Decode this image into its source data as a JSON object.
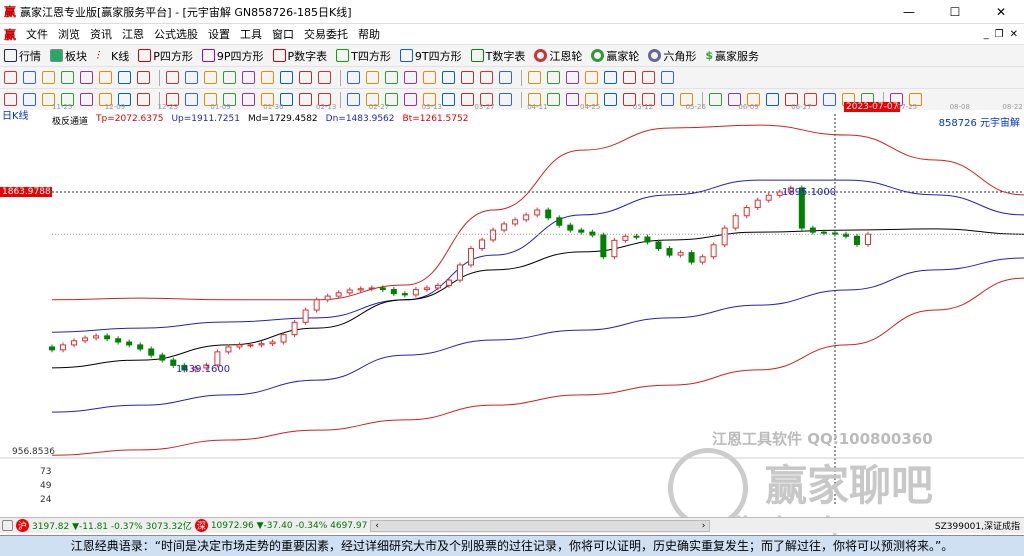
{
  "window": {
    "title": "赢家江恩专业版[赢家服务平台] - [元宇宙解  GN858726-185日K线]",
    "minimize": "—",
    "maximize": "☐",
    "close": "✕"
  },
  "menu": [
    "文件",
    "浏览",
    "资讯",
    "江恩",
    "公式选股",
    "设置",
    "工具",
    "窗口",
    "交易委托",
    "帮助"
  ],
  "toolbar1": [
    "行情",
    "板块",
    "K线",
    "P四方形",
    "9P四方形",
    "P数字表",
    "T四方形",
    "9T四方形",
    "T数字表",
    "江恩轮",
    "赢家轮",
    "六角形",
    "赢家服务"
  ],
  "period_label": "日K线",
  "indicator": {
    "name": "极反通道",
    "tp": "Tp=2072.6375",
    "up": "Up=1911.7251",
    "md": "Md=1729.4582",
    "dn": "Dn=1483.9562",
    "bt": "Bt=1261.5752"
  },
  "symbol_label": "858726  元宇宙解",
  "time_axis": [
    "11-25",
    "12-09",
    "12-23",
    "01-09",
    "01-30",
    "02-13",
    "02-27",
    "03-13",
    "03-27",
    "04-11",
    "04-25",
    "05-12",
    "05-26",
    "06-09",
    "06-27",
    "2023-07-07",
    "07-25",
    "08-08",
    "08-22"
  ],
  "cursor_price": "1863.9788",
  "axis_labels": {
    "low": "956.8536",
    "v1": "73",
    "v2": "49",
    "v3": "24"
  },
  "annotations": {
    "high": "1895.1000",
    "low": "1439.1600"
  },
  "colors": {
    "up": "#e03030",
    "down": "#008000",
    "mid": "#000000",
    "blue": "#2020c0",
    "red": "#d02020"
  },
  "chart_data": {
    "type": "candlestick",
    "closes": [
      1493,
      1505,
      1515,
      1522,
      1527,
      1520,
      1512,
      1505,
      1495,
      1480,
      1468,
      1455,
      1444,
      1449,
      1456,
      1488,
      1500,
      1505,
      1505,
      1508,
      1512,
      1530,
      1560,
      1590,
      1615,
      1624,
      1632,
      1639,
      1642,
      1644,
      1640,
      1630,
      1627,
      1640,
      1644,
      1650,
      1663,
      1700,
      1740,
      1761,
      1785,
      1800,
      1810,
      1822,
      1834,
      1815,
      1797,
      1785,
      1780,
      1773,
      1720,
      1760,
      1770,
      1768,
      1756,
      1740,
      1724,
      1730,
      1707,
      1720,
      1749,
      1790,
      1820,
      1840,
      1858,
      1870,
      1878,
      1888,
      1790,
      1780,
      1778,
      1775,
      1770,
      1750,
      1775
    ],
    "bands": {
      "md": [
        1449,
        1468,
        1505,
        1546,
        1615,
        1688,
        1732,
        1761,
        1780,
        1785,
        1788,
        1775
      ],
      "up": [
        1536,
        1546,
        1561,
        1571,
        1615,
        1724,
        1822,
        1871,
        1907,
        1907,
        1871,
        1822
      ],
      "tp": [
        1615,
        1619,
        1615,
        1615,
        1651,
        1834,
        1980,
        2034,
        2041,
        2017,
        1956,
        1871
      ],
      "dn": [
        1341,
        1358,
        1383,
        1419,
        1480,
        1517,
        1541,
        1571,
        1602,
        1639,
        1688,
        1717
      ],
      "bt": [
        1236,
        1249,
        1273,
        1297,
        1322,
        1358,
        1383,
        1407,
        1444,
        1505,
        1590,
        1668
      ]
    }
  },
  "status": {
    "sh": "3197.82 ▼-11.81 -0.37% 3073.32亿",
    "sz": "10972.96 ▼-37.40 -0.34% 4697.97",
    "sh_badge": "沪",
    "sz_badge": "深",
    "index": "SZ399001,深证成指",
    "left": "‹",
    "right": "›"
  },
  "watermark": {
    "line1": "江恩工具软件  QQ:100800360",
    "line2": "赢家聊吧",
    "line3": "liaoba.vip"
  },
  "quote": "江恩经典语录：“时间是决定市场走势的重要因素，经过详细研究大市及个别股票的过往记录，你将可以证明，历史确实重复发生；而了解过往，你将可以预测将来。”。"
}
